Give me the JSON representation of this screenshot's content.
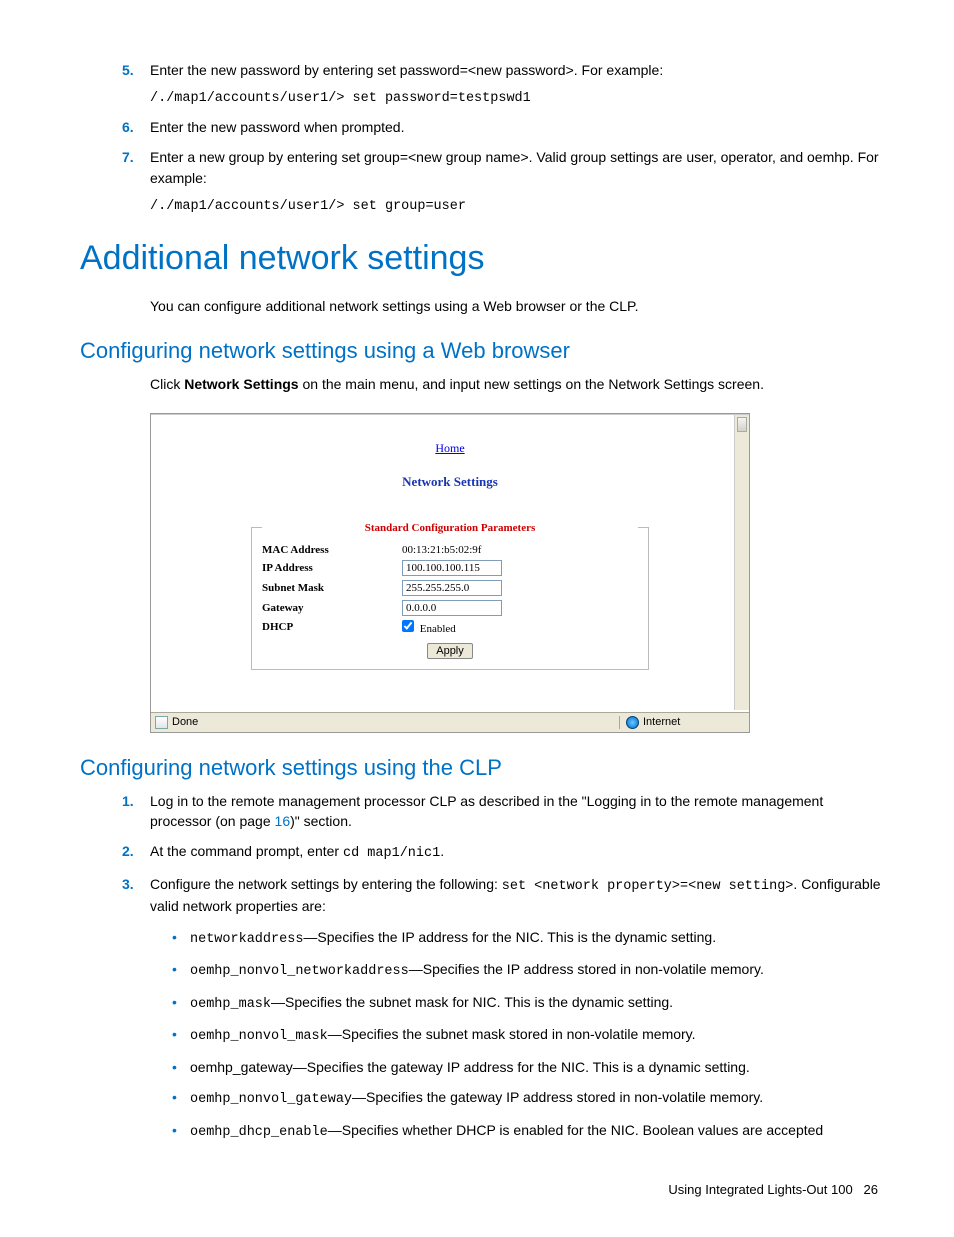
{
  "steps_top": {
    "5": {
      "text": "Enter the new password by entering set password=<new password>. For example:",
      "code": "/./map1/accounts/user1/> set password=testpswd1"
    },
    "6": {
      "text": "Enter the new password when prompted."
    },
    "7": {
      "text": "Enter a new group by entering set group=<new group name>. Valid group settings are user, operator, and oemhp. For example:",
      "code": "/./map1/accounts/user1/> set group=user"
    }
  },
  "h1": "Additional network settings",
  "intro": "You can configure additional network settings using a Web browser or the CLP.",
  "h2_web": "Configuring network settings using a Web browser",
  "web_text_pre": "Click ",
  "web_text_bold": "Network Settings",
  "web_text_post": " on the main menu, and input new settings on the Network Settings screen.",
  "screenshot": {
    "home": "Home",
    "title": "Network Settings",
    "legend": "Standard Configuration Parameters",
    "rows": {
      "mac_label": "MAC Address",
      "mac_value": "00:13:21:b5:02:9f",
      "ip_label": "IP Address",
      "ip_value": "100.100.100.115",
      "mask_label": "Subnet Mask",
      "mask_value": "255.255.255.0",
      "gw_label": "Gateway",
      "gw_value": "0.0.0.0",
      "dhcp_label": "DHCP",
      "dhcp_text": "Enabled"
    },
    "apply": "Apply",
    "status_done": "Done",
    "status_zone": "Internet"
  },
  "h2_clp": "Configuring network settings using the CLP",
  "clp_steps": {
    "1": {
      "pre": "Log in to the remote management processor CLP as described in the \"Logging in to the remote management processor (on page ",
      "page": "16",
      "post": ")\" section."
    },
    "2": {
      "pre": "At the command prompt, enter ",
      "code": "cd map1/nic1",
      "post": "."
    },
    "3": {
      "pre": "Configure the network settings by entering the following: ",
      "code": "set <network property>=<new setting>",
      "post": ". Configurable valid network properties are:"
    }
  },
  "bullets": {
    "b1": {
      "code": "networkaddress",
      "text": "—Specifies the IP address for the NIC. This is the dynamic setting."
    },
    "b2": {
      "code": "oemhp_nonvol_networkaddress",
      "text": "—Specifies the IP address stored in non-volatile memory."
    },
    "b3": {
      "code": "oemhp_mask",
      "text": "—Specifies the subnet mask for NIC. This is the dynamic setting."
    },
    "b4": {
      "code": "oemhp_nonvol_mask",
      "text": "—Specifies the subnet mask stored in non-volatile memory."
    },
    "b5": {
      "plain": "oemhp_gateway—Specifies the gateway IP address for the NIC. This is a dynamic setting."
    },
    "b6": {
      "code": "oemhp_nonvol_gateway",
      "text": "—Specifies the gateway IP address stored in non-volatile memory."
    },
    "b7": {
      "code": "oemhp_dhcp_enable",
      "text": "—Specifies whether DHCP is enabled for the NIC. Boolean values are accepted"
    }
  },
  "footer": {
    "text": "Using Integrated Lights-Out 100",
    "page": "26"
  }
}
